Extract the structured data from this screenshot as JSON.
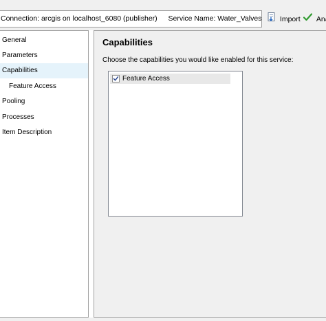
{
  "header": {
    "connection_label": "Connection:",
    "connection_value": "arcgis on localhost_6080 (publisher)",
    "service_label": "Service Name:",
    "service_value": "Water_Valves",
    "import_label": "Import",
    "analyze_label": "Ana"
  },
  "sidebar": {
    "items": [
      {
        "label": "General",
        "selected": false,
        "level": 0
      },
      {
        "label": "Parameters",
        "selected": false,
        "level": 0
      },
      {
        "label": "Capabilities",
        "selected": true,
        "level": 0
      },
      {
        "label": "Feature Access",
        "selected": false,
        "level": 1
      },
      {
        "label": "Pooling",
        "selected": false,
        "level": 0
      },
      {
        "label": "Processes",
        "selected": false,
        "level": 0
      },
      {
        "label": "Item Description",
        "selected": false,
        "level": 0
      }
    ]
  },
  "main": {
    "title": "Capabilities",
    "description": "Choose the capabilities you would like enabled for this service:",
    "capabilities": [
      {
        "label": "Feature Access",
        "checked": true
      }
    ]
  },
  "icons": {
    "import": "import-icon",
    "analyze": "checkmark-icon",
    "checkbox_checked": "checkmark-icon"
  },
  "colors": {
    "selection": "#e5f3fb",
    "panel_background": "#f0f0f0",
    "analyze_check": "#2e9a2e"
  }
}
